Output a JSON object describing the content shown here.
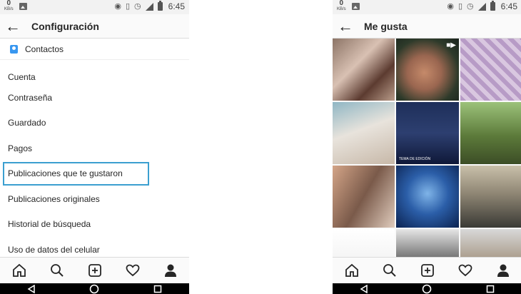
{
  "status_bar": {
    "kbs_value": "0",
    "kbs_unit": "KB/s",
    "time": "6:45"
  },
  "left_screen": {
    "title": "Configuración",
    "contacts_label": "Contactos",
    "section_header": "Cuenta",
    "items": [
      {
        "label": "Contraseña"
      },
      {
        "label": "Guardado"
      },
      {
        "label": "Pagos"
      },
      {
        "label": "Publicaciones que te gustaron",
        "highlighted": true
      },
      {
        "label": "Publicaciones originales"
      },
      {
        "label": "Historial de búsqueda"
      },
      {
        "label": "Uso de datos del celular"
      }
    ]
  },
  "right_screen": {
    "title": "Me gusta",
    "tiles": [
      {
        "desc": "woman-selfie"
      },
      {
        "desc": "man-selfie-video",
        "video": true
      },
      {
        "desc": "baby-on-blanket"
      },
      {
        "desc": "newborn-baby"
      },
      {
        "desc": "group-photo-blue",
        "caption": "TEMA DE EDICIÓN"
      },
      {
        "desc": "man-on-horse"
      },
      {
        "desc": "couple-selfie"
      },
      {
        "desc": "woman-blue-light"
      },
      {
        "desc": "sunset-landscape"
      },
      {
        "desc": "text-post"
      },
      {
        "desc": "woman-portrait"
      },
      {
        "desc": "man-with-dog"
      }
    ]
  },
  "icons": [
    "home-icon",
    "search-icon",
    "add-icon",
    "heart-icon",
    "profile-icon"
  ],
  "colors": {
    "highlight": "#3b9fd0",
    "contact_icon": "#3897f0"
  }
}
